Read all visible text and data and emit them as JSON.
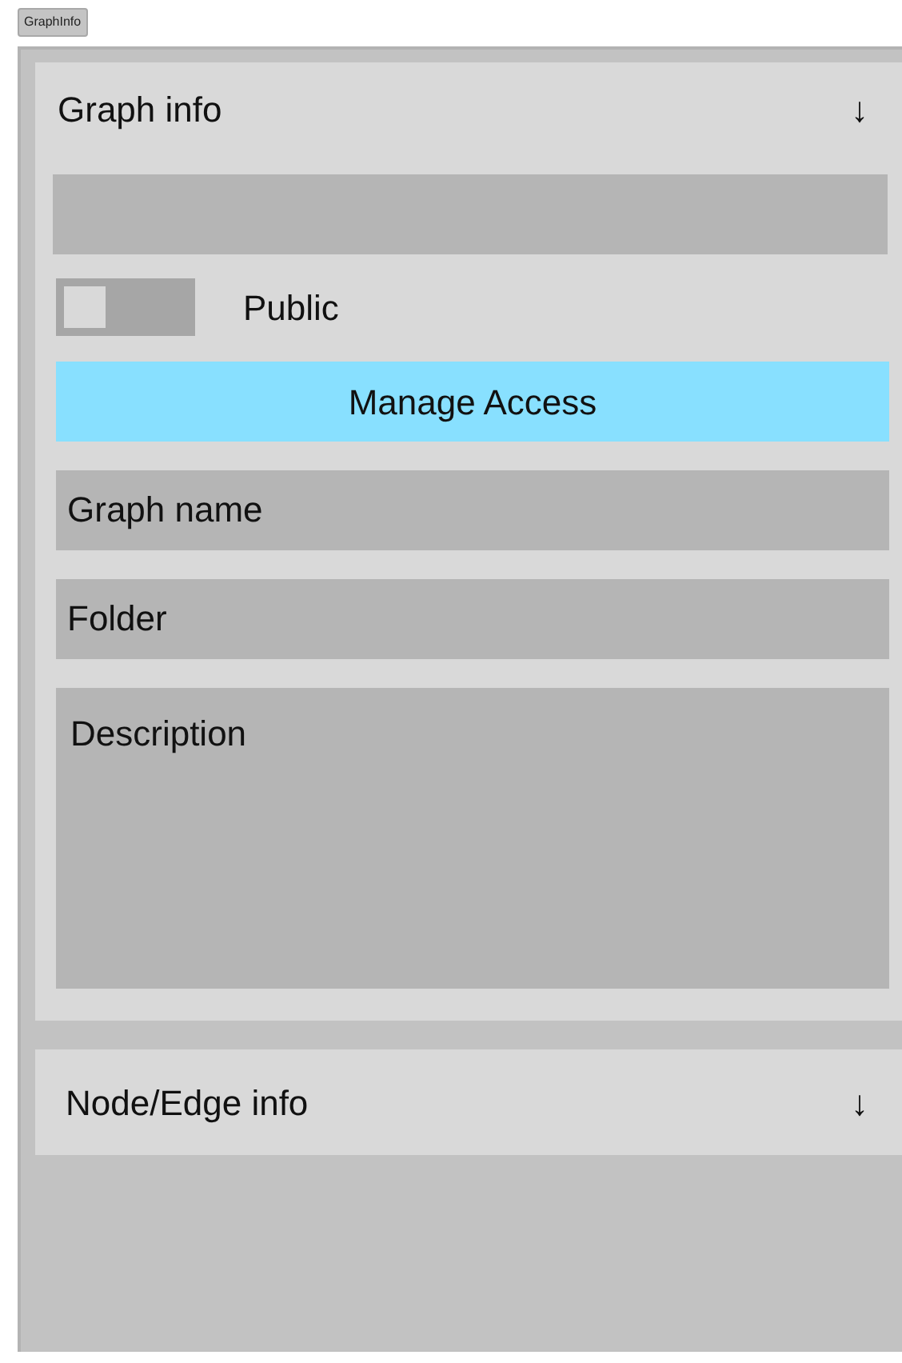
{
  "top_button": {
    "label": "GraphInfo"
  },
  "sections": [
    {
      "title": "Graph info",
      "arrow": "↓",
      "expanded": true,
      "items": [
        {
          "kind": "blank-field"
        },
        {
          "kind": "toggle",
          "label": "Public",
          "checked": false
        },
        {
          "kind": "button",
          "label": "Manage Access"
        },
        {
          "kind": "field",
          "placeholder": "Graph name"
        },
        {
          "kind": "field",
          "placeholder": "Folder"
        },
        {
          "kind": "textarea",
          "placeholder": "Description"
        }
      ]
    },
    {
      "title": "Node/Edge info",
      "arrow": "↓",
      "expanded": false
    }
  ]
}
